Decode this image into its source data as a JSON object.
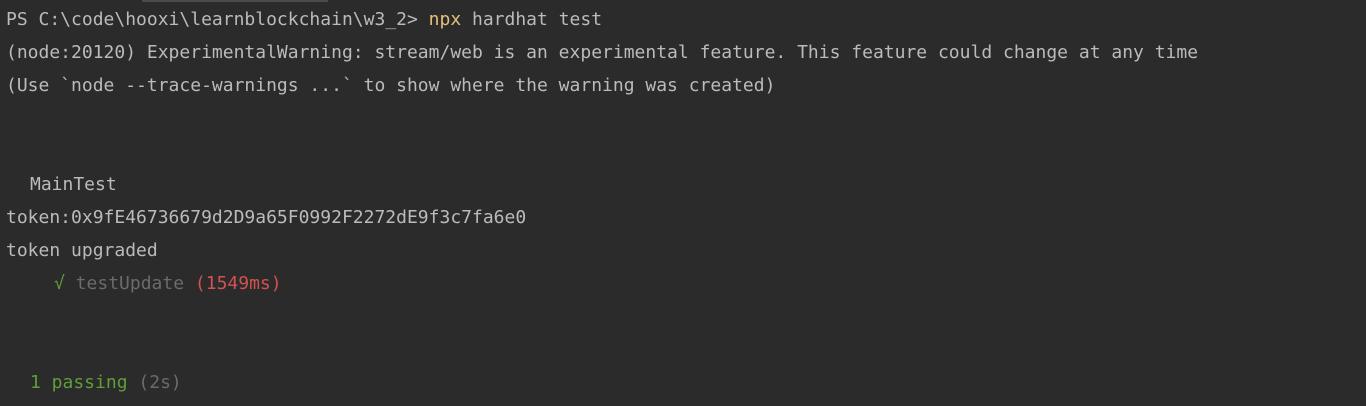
{
  "terminal": {
    "prompt": "PS C:\\code\\hooxi\\learnblockchain\\w3_2> ",
    "command_exe": "npx",
    "command_args": " hardhat test",
    "warning_line": "(node:20120) ExperimentalWarning: stream/web is an experimental feature. This feature could change at any time",
    "trace_line": "(Use `node --trace-warnings ...` to show where the warning was created)",
    "suite_name": "MainTest",
    "token_line": "token:0x9fE46736679d2D9a65F0992F2272dE9f3c7fa6e0",
    "upgraded_line": "token upgraded",
    "check_mark": "√",
    "test_name": "testUpdate",
    "test_duration": "(1549ms)",
    "passing_summary": "1 passing",
    "total_duration": "(2s)"
  },
  "colors": {
    "background": "#2b2b2b",
    "text": "#bbbbbb",
    "command": "#e5c07b",
    "pass": "#5f9e3a",
    "muted": "#6b6b6b",
    "slow": "#d25252"
  }
}
